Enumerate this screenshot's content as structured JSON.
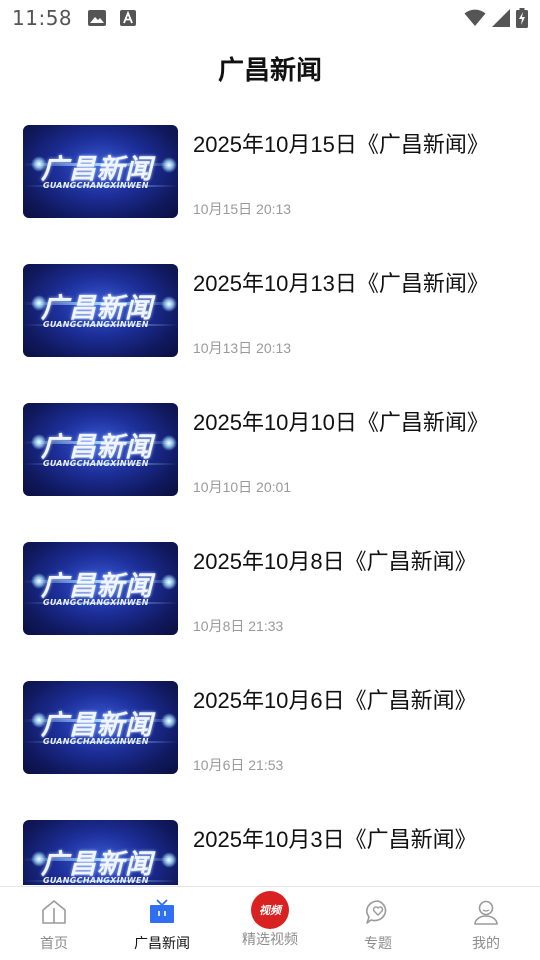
{
  "status_bar": {
    "time": "11:58"
  },
  "header": {
    "title": "广昌新闻"
  },
  "news": [
    {
      "title": "2025年10月15日《广昌新闻》",
      "time": "10月15日 20:13",
      "thumb_logo": "广昌新闻",
      "thumb_sub": "GUANGCHANGXINWEN"
    },
    {
      "title": "2025年10月13日《广昌新闻》",
      "time": "10月13日 20:13",
      "thumb_logo": "广昌新闻",
      "thumb_sub": "GUANGCHANGXINWEN"
    },
    {
      "title": "2025年10月10日《广昌新闻》",
      "time": "10月10日 20:01",
      "thumb_logo": "广昌新闻",
      "thumb_sub": "GUANGCHANGXINWEN"
    },
    {
      "title": "2025年10月8日《广昌新闻》",
      "time": "10月8日 21:33",
      "thumb_logo": "广昌新闻",
      "thumb_sub": "GUANGCHANGXINWEN"
    },
    {
      "title": "2025年10月6日《广昌新闻》",
      "time": "10月6日 21:53",
      "thumb_logo": "广昌新闻",
      "thumb_sub": "GUANGCHANGXINWEN"
    },
    {
      "title": "2025年10月3日《广昌新闻》",
      "time": "",
      "thumb_logo": "广昌新闻",
      "thumb_sub": "GUANGCHANGXINWEN"
    }
  ],
  "bottom_nav": {
    "items": [
      {
        "label": "首页",
        "icon": "home-icon"
      },
      {
        "label": "广昌新闻",
        "icon": "tv-icon",
        "active": true
      },
      {
        "label": "精选视频",
        "icon": "video-badge-icon",
        "badge_text": "视频"
      },
      {
        "label": "专题",
        "icon": "heart-chat-icon"
      },
      {
        "label": "我的",
        "icon": "user-icon"
      }
    ]
  },
  "colors": {
    "accent_blue": "#2f6ff0",
    "video_red": "#d92121",
    "muted_text": "#9a9a9a"
  }
}
